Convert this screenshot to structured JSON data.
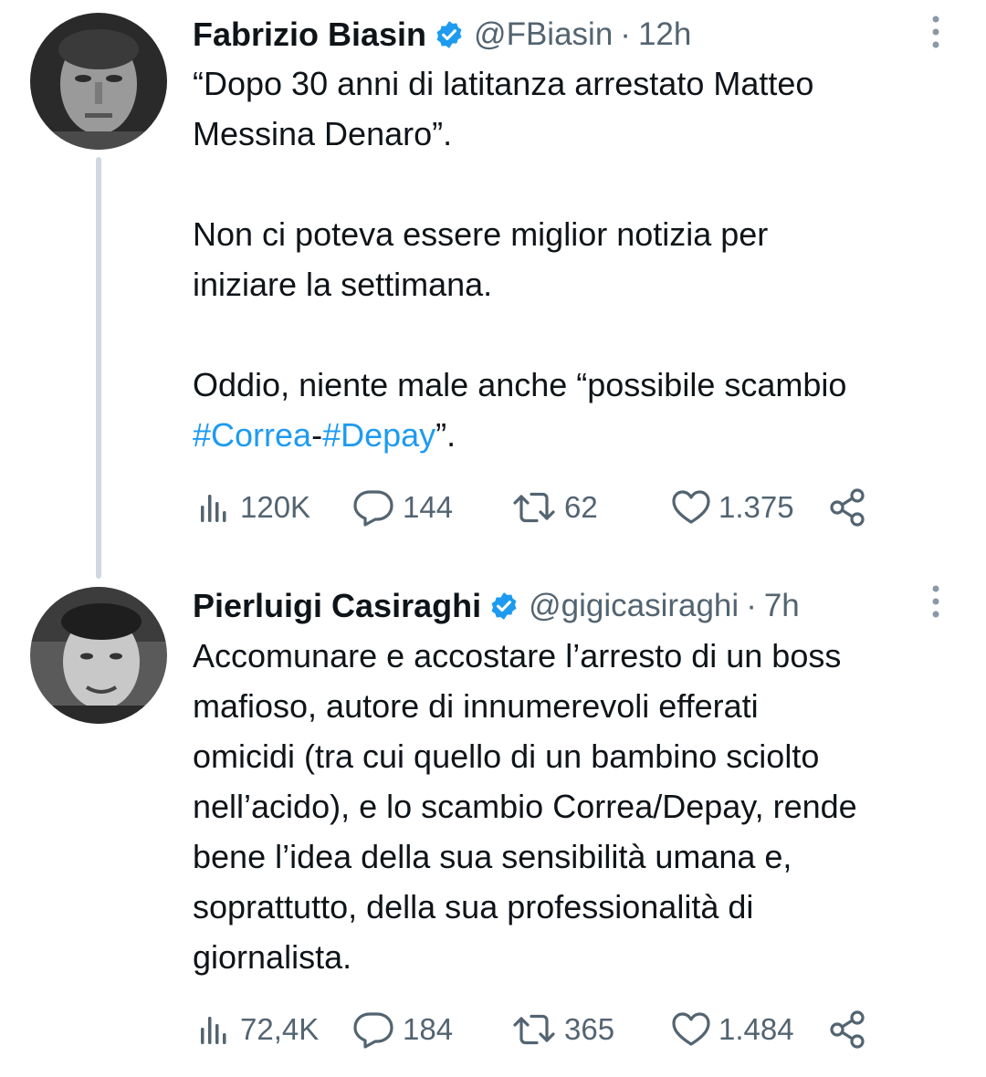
{
  "tweets": [
    {
      "author_name": "Fabrizio Biasin",
      "handle": "@FBiasin",
      "separator": "·",
      "time": "12h",
      "body_part1": "“Dopo 30 anni di latitanza arrestato Matteo\nMessina Denaro”.\n\nNon ci poteva essere miglior notizia per\niniziare la settimana.\n\nOddio, niente male anche “possibile scambio\n",
      "hashtag1": "#Correa",
      "hashtag_joiner": "-",
      "hashtag2": "#Depay",
      "body_end": "”.",
      "views": "120K",
      "replies": "144",
      "retweets": "62",
      "likes": "1.375"
    },
    {
      "author_name": "Pierluigi Casiraghi",
      "handle": "@gigicasiraghi",
      "separator": "·",
      "time": "7h",
      "body": "Accomunare e accostare l’arresto di un boss\nmafioso, autore di innumerevoli efferati\nomicidi (tra cui quello di un bambino sciolto\nnell’acido), e lo scambio Correa/Depay, rende\nbene l’idea della sua sensibilità umana e,\nsoprattutto, della sua professionalità di\ngiornalista.",
      "views": "72,4K",
      "replies": "184",
      "retweets": "365",
      "likes": "1.484"
    }
  ],
  "colors": {
    "text": "#0f1419",
    "secondary": "#536471",
    "accent": "#1d9bf0",
    "thread_line": "#cfd9de"
  },
  "icons": [
    "verified-badge-icon",
    "more-options-icon",
    "views-icon",
    "reply-icon",
    "retweet-icon",
    "like-icon",
    "share-icon"
  ]
}
